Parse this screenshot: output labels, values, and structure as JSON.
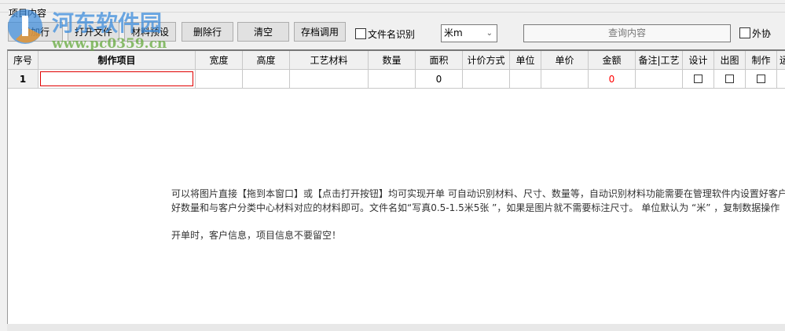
{
  "group_label": "项目内容",
  "toolbar": {
    "buttons": [
      "增加行",
      "打开文件",
      "材料预设",
      "删除行",
      "清空",
      "存档调用"
    ],
    "filename_recognition": "文件名识别",
    "unit_select": "米m",
    "search_placeholder": "查询内容",
    "outsource": "外协"
  },
  "table": {
    "headers": [
      "序号",
      "制作项目",
      "宽度",
      "高度",
      "工艺材料",
      "数量",
      "面积",
      "计价方式",
      "单位",
      "单价",
      "金额",
      "备注|工艺",
      "设计",
      "出图",
      "制作",
      "运"
    ],
    "rows": [
      {
        "index": "1",
        "area": "0",
        "amount": "0"
      }
    ]
  },
  "hints": [
    "可以将图片直接【拖到本窗口】或【点击打开按钮】均可实现开单 可自动识别材料、尺寸、数量等，自动识别材料功能需要在管理软件内设置好客户",
    "好数量和与客户分类中心材料对应的材料即可。文件名如“写真0.5-1.5米5张 ”，如果是图片就不需要标注尺寸。 单位默认为 “米” ，复制数据操作",
    "开单时，客户信息，项目信息不要留空！"
  ],
  "watermark": {
    "title": "河东软件园",
    "url": "www.pc0359.cn"
  },
  "colors": {
    "amount": "#ff0000",
    "editing_border": "#e00000"
  }
}
